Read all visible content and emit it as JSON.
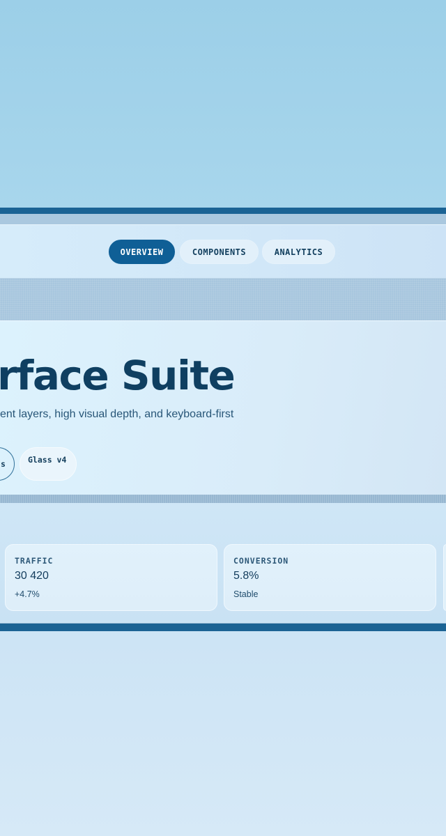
{
  "nav": {
    "tabs": [
      {
        "label": "OVERVIEW",
        "active": true
      },
      {
        "label": "COMPONENTS",
        "active": false
      },
      {
        "label": "ANALYTICS",
        "active": false
      }
    ]
  },
  "hero": {
    "title": "rface Suite",
    "subtitle": "ent layers, high visual depth, and keyboard-first",
    "pills": [
      {
        "label": "s"
      },
      {
        "label": "Glass v4"
      }
    ]
  },
  "stats": [
    {
      "label": "TRAFFIC",
      "value": "30 420",
      "note": "+4.7%"
    },
    {
      "label": "CONVERSION",
      "value": "5.8%",
      "note": "Stable"
    }
  ],
  "colors": {
    "accent": "#0f5f96",
    "frame": "#1b6394",
    "text": "#0f3f61"
  }
}
